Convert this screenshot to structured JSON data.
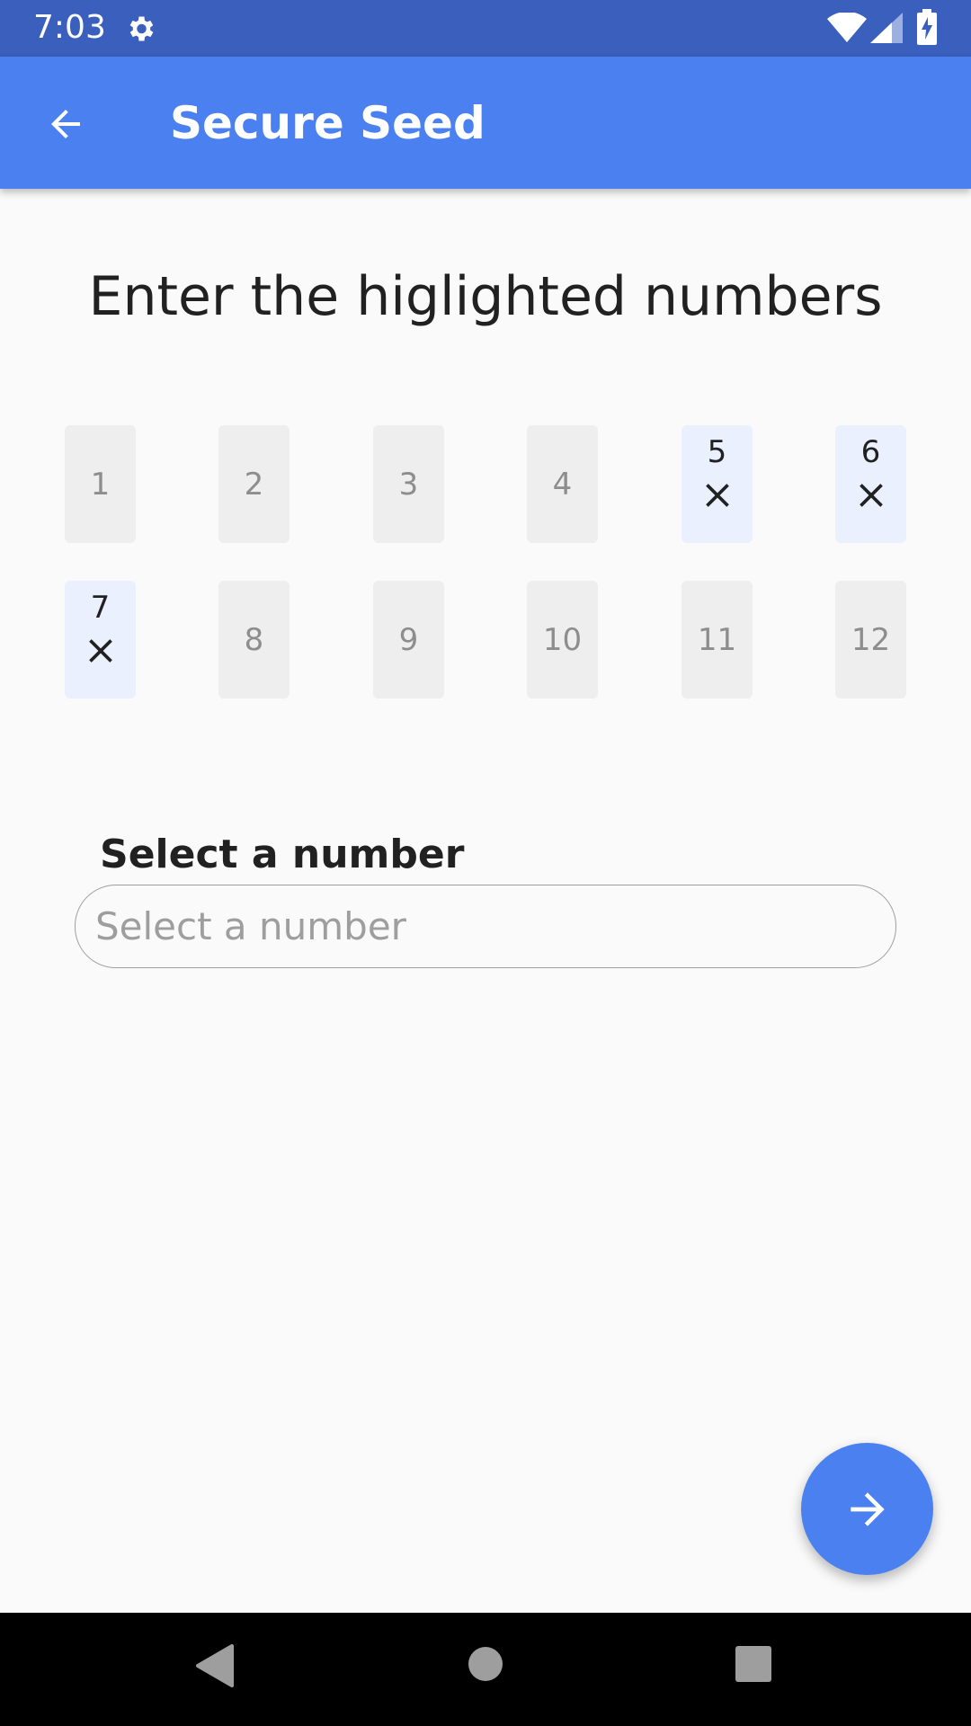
{
  "status_bar": {
    "time": "7:03",
    "icons": [
      "gear-icon",
      "wifi-icon",
      "signal-icon",
      "battery-charging-icon"
    ]
  },
  "app_bar": {
    "title": "Secure Seed",
    "back_icon": "arrow-left-icon"
  },
  "heading": "Enter the higlighted numbers",
  "word_grid": {
    "row1": [
      {
        "number": "1",
        "highlighted": false
      },
      {
        "number": "2",
        "highlighted": false
      },
      {
        "number": "3",
        "highlighted": false
      },
      {
        "number": "4",
        "highlighted": false
      },
      {
        "number": "5",
        "highlighted": true
      },
      {
        "number": "6",
        "highlighted": true
      }
    ],
    "row2": [
      {
        "number": "7",
        "highlighted": true
      },
      {
        "number": "8",
        "highlighted": false
      },
      {
        "number": "9",
        "highlighted": false
      },
      {
        "number": "10",
        "highlighted": false
      },
      {
        "number": "11",
        "highlighted": false
      },
      {
        "number": "12",
        "highlighted": false
      }
    ]
  },
  "select": {
    "label": "Select a number",
    "placeholder": "Select a number",
    "value": ""
  },
  "fab": {
    "icon": "arrow-right-icon"
  },
  "colors": {
    "status_bar": "#3a5fbc",
    "app_bar": "#4a80f0",
    "highlight_box": "#eaf0fd",
    "box": "#eeeeee"
  },
  "nav_bar": {
    "icons": [
      "nav-back-icon",
      "nav-home-icon",
      "nav-recents-icon"
    ]
  }
}
